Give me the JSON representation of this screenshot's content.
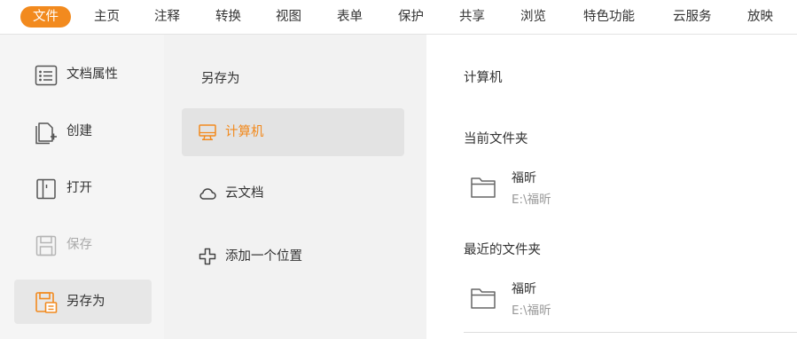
{
  "menu": {
    "items": [
      {
        "label": "文件",
        "active": true
      },
      {
        "label": "主页"
      },
      {
        "label": "注释"
      },
      {
        "label": "转换"
      },
      {
        "label": "视图"
      },
      {
        "label": "表单"
      },
      {
        "label": "保护"
      },
      {
        "label": "共享"
      },
      {
        "label": "浏览"
      },
      {
        "label": "特色功能"
      },
      {
        "label": "云服务"
      },
      {
        "label": "放映"
      }
    ]
  },
  "leftnav": {
    "items": [
      {
        "label": "文档属性",
        "icon": "document-properties-icon"
      },
      {
        "label": "创建",
        "icon": "create-document-icon"
      },
      {
        "label": "打开",
        "icon": "open-book-icon"
      },
      {
        "label": "保存",
        "icon": "save-icon",
        "disabled": true
      },
      {
        "label": "另存为",
        "icon": "save-as-icon",
        "selected": true
      }
    ]
  },
  "saveas": {
    "title": "另存为",
    "locations": [
      {
        "label": "计算机",
        "icon": "computer-icon",
        "selected": true
      },
      {
        "label": "云文档",
        "icon": "cloud-icon"
      },
      {
        "label": "添加一个位置",
        "icon": "plus-icon"
      }
    ]
  },
  "computer": {
    "title": "计算机",
    "current_folder_title": "当前文件夹",
    "current_folder": {
      "name": "福昕",
      "path": "E:\\福昕"
    },
    "recent_folders_title": "最近的文件夹",
    "recent_folders": [
      {
        "name": "福昕",
        "path": "E:\\福昕"
      }
    ]
  },
  "colors": {
    "accent": "#f28a1e",
    "nav_bg": "#f5f5f5",
    "mid_bg": "#f2f2f2",
    "selected_bg": "#e3e3e3",
    "muted_text": "#999999"
  }
}
